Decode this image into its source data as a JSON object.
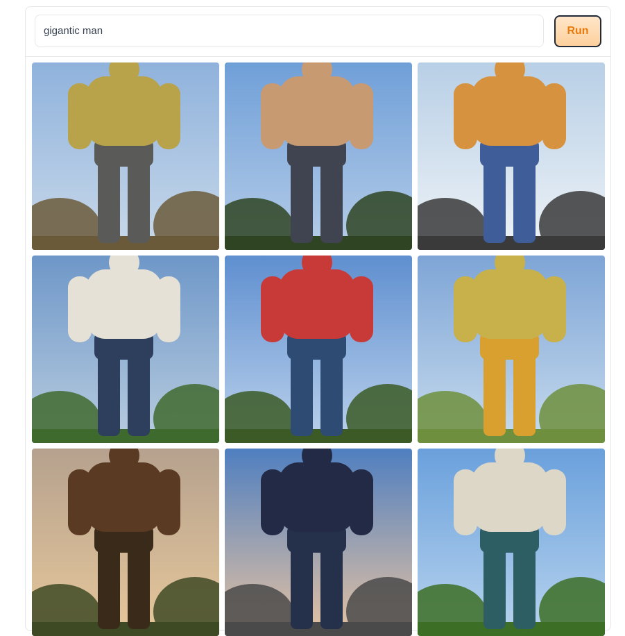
{
  "prompt": {
    "value": "gigantic man"
  },
  "run_button": {
    "label": "Run",
    "color": "#ea7a0c"
  },
  "gallery": {
    "images": [
      {
        "name": "generated-image-1",
        "sky": [
          "#8fb2dc",
          "#c9d9ea"
        ],
        "torso": "#b8a24a",
        "pants": "#5a5a58",
        "ground": "#6b5a3a"
      },
      {
        "name": "generated-image-2",
        "sky": [
          "#6f9fd8",
          "#b6cde8"
        ],
        "torso": "#c89a72",
        "pants": "#3f4450",
        "ground": "#2f4422"
      },
      {
        "name": "generated-image-3",
        "sky": [
          "#b8cfe6",
          "#eef3f7"
        ],
        "torso": "#d6923e",
        "pants": "#3f5e99",
        "ground": "#3a3a3a"
      },
      {
        "name": "generated-image-4",
        "sky": [
          "#6e97c8",
          "#b9cde0"
        ],
        "torso": "#e6e1d6",
        "pants": "#2d3f5c",
        "ground": "#3f6a2e"
      },
      {
        "name": "generated-image-5",
        "sky": [
          "#5f8fd0",
          "#bcd2ec"
        ],
        "torso": "#c73a37",
        "pants": "#2e4b73",
        "ground": "#3b5a26"
      },
      {
        "name": "generated-image-6",
        "sky": [
          "#7ea5d6",
          "#c7dbee"
        ],
        "torso": "#c8b04a",
        "pants": "#d9a030",
        "ground": "#6e8f3d"
      },
      {
        "name": "generated-image-7",
        "sky": [
          "#b5a18e",
          "#e7c89b"
        ],
        "torso": "#5a3a22",
        "pants": "#3a2a1a",
        "ground": "#3e4a24"
      },
      {
        "name": "generated-image-8",
        "sky": [
          "#4f7fc0",
          "#e6c3a2"
        ],
        "torso": "#232a45",
        "pants": "#25304a",
        "ground": "#4a4a4a"
      },
      {
        "name": "generated-image-9",
        "sky": [
          "#6aa0dc",
          "#b8d4ee"
        ],
        "torso": "#ddd7c8",
        "pants": "#2d5e63",
        "ground": "#3d6e26"
      }
    ]
  }
}
